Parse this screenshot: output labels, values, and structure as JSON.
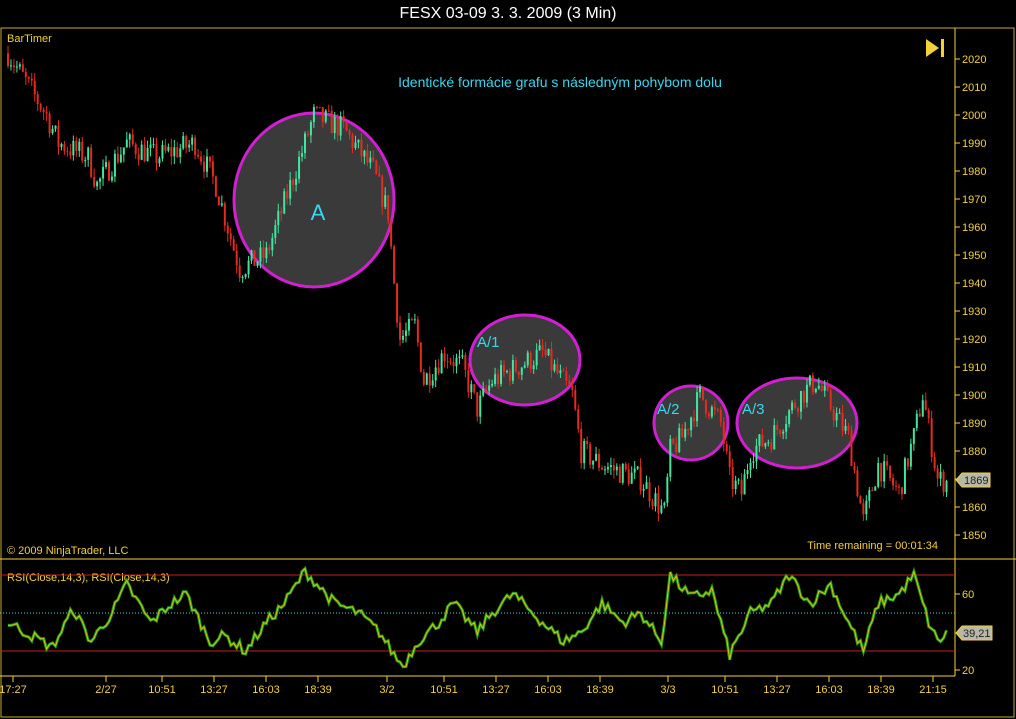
{
  "window_title": "FESX 03-09  3. 3. 2009 (3 Min)",
  "chart_data": [
    {
      "type": "candlestick",
      "title": "FESX 03-09  3. 3. 2009 (3 Min)",
      "indicator_label": "BarTimer",
      "annotation_title": "Identické formácie grafu s následným pohybom dolu",
      "annotations": [
        "A",
        "A/1",
        "A/2",
        "A/3"
      ],
      "copyright": "© 2009 NinjaTrader, LLC",
      "time_remaining": "Time remaining = 00:01:34",
      "last_price_label": "1869",
      "last_price": 1869,
      "ylim": [
        1840,
        2028
      ],
      "yticks": [
        2020,
        2010,
        2000,
        1990,
        1980,
        1970,
        1960,
        1950,
        1940,
        1930,
        1920,
        1910,
        1900,
        1890,
        1880,
        1870,
        1860,
        1850
      ],
      "close_path": [
        [
          0,
          2022
        ],
        [
          13,
          2000
        ],
        [
          17,
          1990
        ],
        [
          27,
          1985
        ],
        [
          30,
          1975
        ],
        [
          40,
          1990
        ],
        [
          50,
          1985
        ],
        [
          63,
          1990
        ],
        [
          70,
          1975
        ],
        [
          78,
          1945
        ],
        [
          87,
          1950
        ],
        [
          100,
          1990
        ],
        [
          103,
          2000
        ],
        [
          113,
          1995
        ],
        [
          123,
          1980
        ],
        [
          128,
          1965
        ],
        [
          130,
          1940
        ],
        [
          132,
          1920
        ],
        [
          137,
          1925
        ],
        [
          140,
          1905
        ],
        [
          147,
          1915
        ],
        [
          153,
          1910
        ],
        [
          158,
          1895
        ],
        [
          163,
          1905
        ],
        [
          180,
          1915
        ],
        [
          190,
          1900
        ],
        [
          193,
          1880
        ],
        [
          200,
          1875
        ],
        [
          213,
          1870
        ],
        [
          221,
          1858
        ],
        [
          223,
          1880
        ],
        [
          227,
          1885
        ],
        [
          233,
          1900
        ],
        [
          240,
          1890
        ],
        [
          243,
          1870
        ],
        [
          247,
          1865
        ],
        [
          250,
          1880
        ],
        [
          257,
          1885
        ],
        [
          267,
          1900
        ],
        [
          272,
          1905
        ],
        [
          283,
          1885
        ],
        [
          288,
          1855
        ],
        [
          293,
          1875
        ],
        [
          300,
          1865
        ],
        [
          305,
          1885
        ],
        [
          308,
          1900
        ],
        [
          313,
          1870
        ],
        [
          316,
          1869
        ]
      ],
      "colors": {
        "up": "#3fe6a0",
        "down": "#e52a20",
        "axis": "#f2d13a",
        "annotation": "#d21fd2",
        "annotation_text": "#35d8f0"
      }
    },
    {
      "type": "line",
      "title": "RSI(Close,14,3), RSI(Close,14,3)",
      "ylim": [
        15,
        80
      ],
      "yticks": [
        60,
        20
      ],
      "levels": [
        70,
        50,
        30
      ],
      "last_value_label": "39,21",
      "path": [
        [
          0,
          45
        ],
        [
          8,
          38
        ],
        [
          15,
          32
        ],
        [
          22,
          52
        ],
        [
          28,
          35
        ],
        [
          35,
          50
        ],
        [
          40,
          65
        ],
        [
          48,
          45
        ],
        [
          55,
          55
        ],
        [
          60,
          60
        ],
        [
          68,
          35
        ],
        [
          73,
          38
        ],
        [
          80,
          30
        ],
        [
          87,
          45
        ],
        [
          93,
          55
        ],
        [
          100,
          72
        ],
        [
          110,
          55
        ],
        [
          118,
          50
        ],
        [
          125,
          40
        ],
        [
          130,
          28
        ],
        [
          133,
          22
        ],
        [
          138,
          35
        ],
        [
          145,
          45
        ],
        [
          150,
          55
        ],
        [
          158,
          40
        ],
        [
          163,
          50
        ],
        [
          170,
          60
        ],
        [
          180,
          45
        ],
        [
          187,
          35
        ],
        [
          193,
          40
        ],
        [
          200,
          55
        ],
        [
          207,
          45
        ],
        [
          213,
          50
        ],
        [
          220,
          35
        ],
        [
          223,
          70
        ],
        [
          230,
          58
        ],
        [
          237,
          62
        ],
        [
          243,
          28
        ],
        [
          250,
          50
        ],
        [
          257,
          55
        ],
        [
          263,
          70
        ],
        [
          270,
          55
        ],
        [
          277,
          65
        ],
        [
          283,
          45
        ],
        [
          288,
          30
        ],
        [
          293,
          55
        ],
        [
          300,
          60
        ],
        [
          305,
          70
        ],
        [
          310,
          45
        ],
        [
          313,
          35
        ],
        [
          316,
          39
        ]
      ]
    }
  ],
  "time_axis": [
    "17:27",
    "2/27",
    "10:51",
    "13:27",
    "16:03",
    "18:39",
    "3/2",
    "10:51",
    "13:27",
    "16:03",
    "18:39",
    "3/3",
    "10:51",
    "13:27",
    "16:03",
    "18:39",
    "21:15"
  ]
}
